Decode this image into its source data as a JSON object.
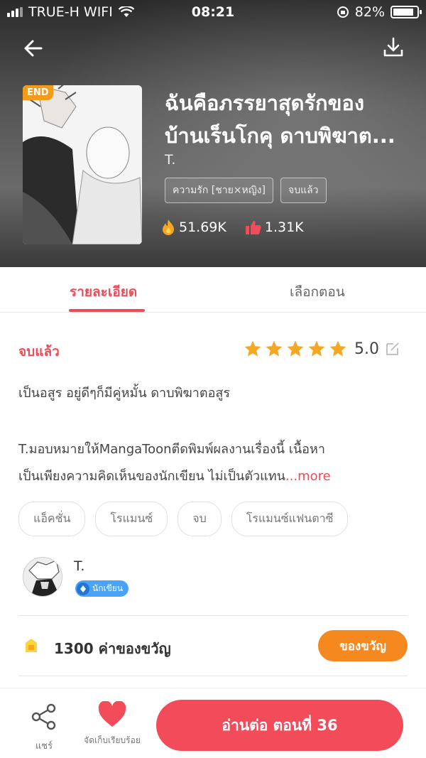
{
  "status_bar": {
    "carrier": "TRUE-H WIFI",
    "time": "08:21",
    "battery": "82%"
  },
  "header": {
    "badge": "END",
    "title_line1": "ฉันคือภรรยาสุดรักของ",
    "title_line2": "บ้านเร็นโกคุ ดาบพิฆาต...",
    "author": "T.",
    "genre_tags": [
      "ความรัก [ชาย×หญิง]",
      "จบแล้ว"
    ],
    "views": "51.69K",
    "likes": "1.31K"
  },
  "tabs": {
    "detail": "รายละเอียด",
    "episodes": "เลือกตอน"
  },
  "detail": {
    "status": "จบแล้ว",
    "rating": "5.0",
    "rating_stars": 5,
    "summary": "เป็นอสูร อยู่ดีๆก็มีคู่หมั้น ดาบพิฆาตอสูร",
    "desc_line1": "T.มอบหมายให้MangaToonตีดพิมพ์ผลงานเรื่องนี้ เนื้อหา",
    "desc_line2": "เป็นเพียงความคิดเห็นของนักเขียน ไม่เป็นตัวแทน",
    "more": "...more",
    "tags": [
      "แอ็คชั่น",
      "โรแมนซ์",
      "จบ",
      "โรแมนซ์แฟนตาซี"
    ]
  },
  "author_card": {
    "name": "T.",
    "badge": "นักเขียน"
  },
  "gift": {
    "count_label": "1300 ค่าของขวัญ",
    "button": "ของขวัญ"
  },
  "bottom_bar": {
    "share": "แชร์",
    "favorite": "จัดเก็บเรียบร้อย",
    "read_button": "อ่านต่อ ตอนที่ 36"
  },
  "colors": {
    "accent": "#ee4b59",
    "gift_orange": "#f5881e",
    "star": "#f5a623"
  }
}
